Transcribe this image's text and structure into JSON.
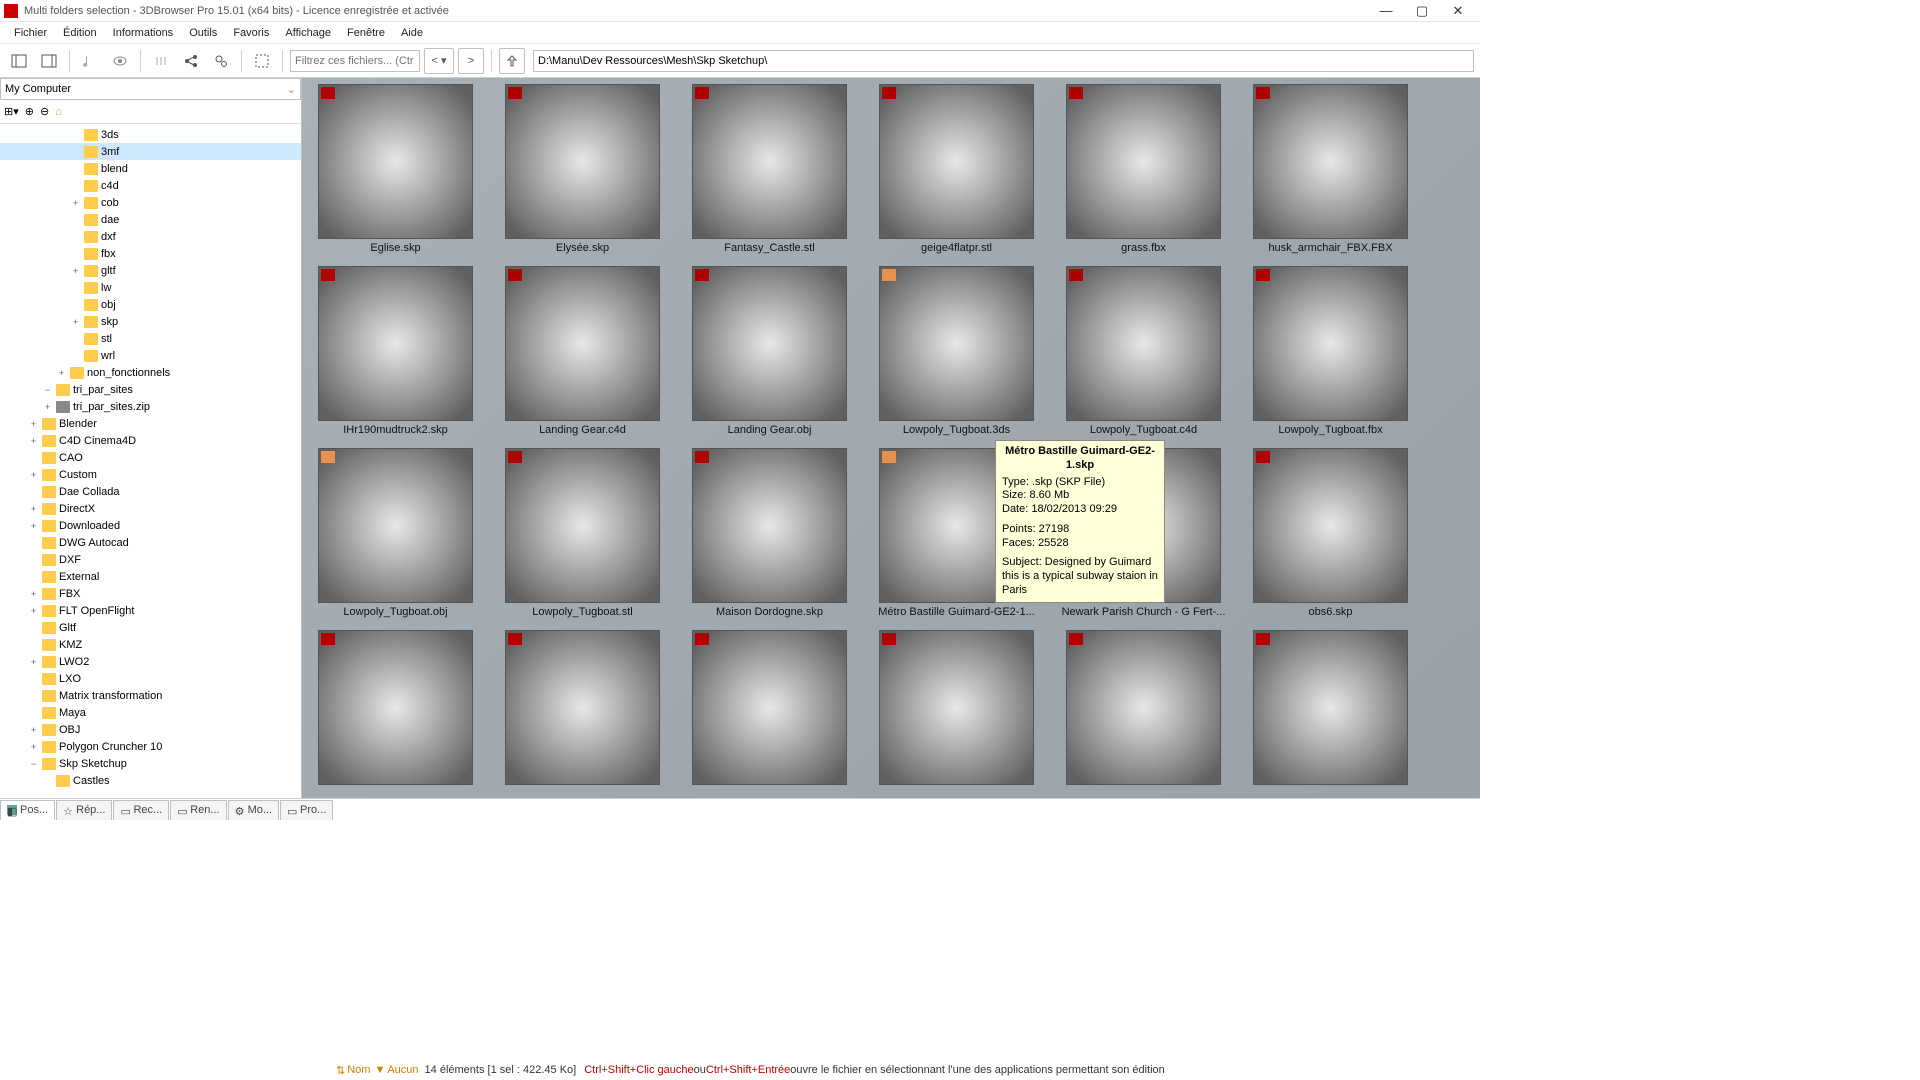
{
  "title": "Multi folders selection - 3DBrowser Pro 15.01 (x64 bits) - Licence enregistrée  et activée",
  "menu": [
    "Fichier",
    "Édition",
    "Informations",
    "Outils",
    "Favoris",
    "Affichage",
    "Fenêtre",
    "Aide"
  ],
  "filter_placeholder": "Filtrez ces fichiers... (Ctr",
  "path": "D:\\Manu\\Dev Ressources\\Mesh\\Skp Sketchup\\",
  "sidebar_header": "My Computer",
  "tree": [
    {
      "d": 5,
      "e": "",
      "l": "3ds"
    },
    {
      "d": 5,
      "e": "",
      "l": "3mf",
      "sel": true
    },
    {
      "d": 5,
      "e": "",
      "l": "blend"
    },
    {
      "d": 5,
      "e": "",
      "l": "c4d"
    },
    {
      "d": 5,
      "e": "+",
      "l": "cob"
    },
    {
      "d": 5,
      "e": "",
      "l": "dae"
    },
    {
      "d": 5,
      "e": "",
      "l": "dxf"
    },
    {
      "d": 5,
      "e": "",
      "l": "fbx"
    },
    {
      "d": 5,
      "e": "+",
      "l": "gltf"
    },
    {
      "d": 5,
      "e": "",
      "l": "lw"
    },
    {
      "d": 5,
      "e": "",
      "l": "obj"
    },
    {
      "d": 5,
      "e": "+",
      "l": "skp"
    },
    {
      "d": 5,
      "e": "",
      "l": "stl"
    },
    {
      "d": 5,
      "e": "",
      "l": "wrl"
    },
    {
      "d": 4,
      "e": "+",
      "l": "non_fonctionnels"
    },
    {
      "d": 3,
      "e": "−",
      "l": "tri_par_sites"
    },
    {
      "d": 3,
      "e": "+",
      "l": "tri_par_sites.zip",
      "zip": true
    },
    {
      "d": 2,
      "e": "+",
      "l": "Blender"
    },
    {
      "d": 2,
      "e": "+",
      "l": "C4D Cinema4D"
    },
    {
      "d": 2,
      "e": "",
      "l": "CAO"
    },
    {
      "d": 2,
      "e": "+",
      "l": "Custom"
    },
    {
      "d": 2,
      "e": "",
      "l": "Dae Collada"
    },
    {
      "d": 2,
      "e": "+",
      "l": "DirectX"
    },
    {
      "d": 2,
      "e": "+",
      "l": "Downloaded"
    },
    {
      "d": 2,
      "e": "",
      "l": "DWG Autocad"
    },
    {
      "d": 2,
      "e": "",
      "l": "DXF"
    },
    {
      "d": 2,
      "e": "",
      "l": "External"
    },
    {
      "d": 2,
      "e": "+",
      "l": "FBX"
    },
    {
      "d": 2,
      "e": "+",
      "l": "FLT OpenFlight"
    },
    {
      "d": 2,
      "e": "",
      "l": "Gltf"
    },
    {
      "d": 2,
      "e": "",
      "l": "KMZ"
    },
    {
      "d": 2,
      "e": "+",
      "l": "LWO2"
    },
    {
      "d": 2,
      "e": "",
      "l": "LXO"
    },
    {
      "d": 2,
      "e": "",
      "l": "Matrix transformation"
    },
    {
      "d": 2,
      "e": "",
      "l": "Maya"
    },
    {
      "d": 2,
      "e": "+",
      "l": "OBJ"
    },
    {
      "d": 2,
      "e": "+",
      "l": "Polygon Cruncher 10"
    },
    {
      "d": 2,
      "e": "−",
      "l": "Skp Sketchup"
    },
    {
      "d": 3,
      "e": "",
      "l": "Castles"
    }
  ],
  "thumbs": [
    {
      "l": "Eglise.skp"
    },
    {
      "l": "Elysée.skp"
    },
    {
      "l": "Fantasy_Castle.stl"
    },
    {
      "l": "geige4flatpr.stl"
    },
    {
      "l": "grass.fbx"
    },
    {
      "l": "husk_armchair_FBX.FBX"
    },
    {
      "l": "IHr190mudtruck2.skp"
    },
    {
      "l": "Landing Gear.c4d"
    },
    {
      "l": "Landing Gear.obj"
    },
    {
      "l": "Lowpoly_Tugboat.3ds",
      "b": "o"
    },
    {
      "l": "Lowpoly_Tugboat.c4d"
    },
    {
      "l": "Lowpoly_Tugboat.fbx"
    },
    {
      "l": "Lowpoly_Tugboat.obj",
      "b": "o"
    },
    {
      "l": "Lowpoly_Tugboat.stl"
    },
    {
      "l": "Maison Dordogne.skp"
    },
    {
      "l": "Métro Bastille Guimard-GE2-1...",
      "b": "o"
    },
    {
      "l": "Newark Parish Church - G Fert-..."
    },
    {
      "l": "obs6.skp"
    },
    {
      "l": ""
    },
    {
      "l": ""
    },
    {
      "l": ""
    },
    {
      "l": ""
    },
    {
      "l": ""
    },
    {
      "l": ""
    }
  ],
  "tooltip": {
    "title": "Métro Bastille Guimard-GE2-1.skp",
    "type": "Type: .skp (SKP File)",
    "size": "Size: 8.60 Mb",
    "date": "Date: 18/02/2013 09:29",
    "points": "Points: 27198",
    "faces": "Faces: 25528",
    "subject": "Subject: Designed by Guimard this is a typical subway staion in Paris"
  },
  "tabs": [
    "Pos...",
    "Rép...",
    "Rec...",
    "Ren...",
    "Mo...",
    "Pro..."
  ],
  "status": {
    "sort": "Nom",
    "filter": "Aucun",
    "count": "14 éléments  [1 sel : 422.45 Ko]",
    "shortcut1": "Ctrl+Shift+Clic gauche",
    "or": " ou ",
    "shortcut2": "Ctrl+Shift+Entrée",
    "rest": " ouvre le fichier en sélectionnant l'une des applications permettant son édition"
  }
}
